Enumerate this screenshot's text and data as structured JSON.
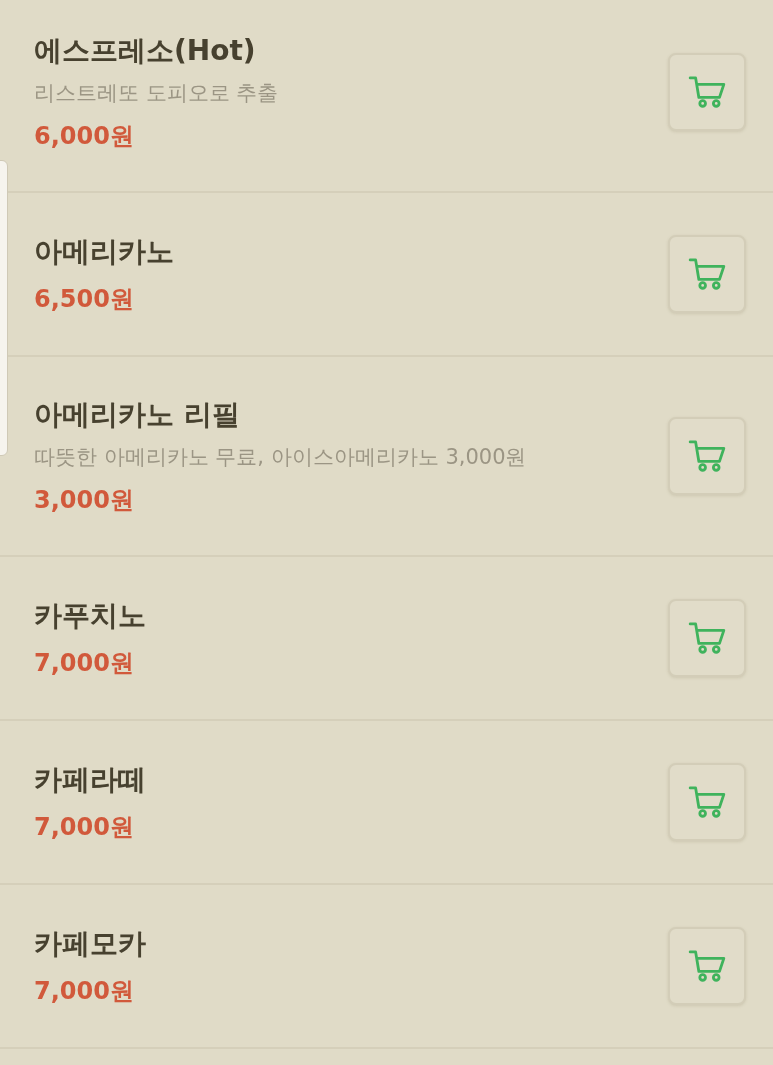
{
  "menu_items": [
    {
      "name": "에스프레소(Hot)",
      "description": "리스트레또 도피오로 추출",
      "price": "6,000원"
    },
    {
      "name": "아메리카노",
      "price": "6,500원"
    },
    {
      "name": "아메리카노 리필",
      "description": "따뜻한 아메리카노 무료, 아이스아메리카노 3,000원",
      "price": "3,000원"
    },
    {
      "name": "카푸치노",
      "price": "7,000원"
    },
    {
      "name": "카페라떼",
      "price": "7,000원"
    },
    {
      "name": "카페모카",
      "price": "7,000원"
    }
  ]
}
